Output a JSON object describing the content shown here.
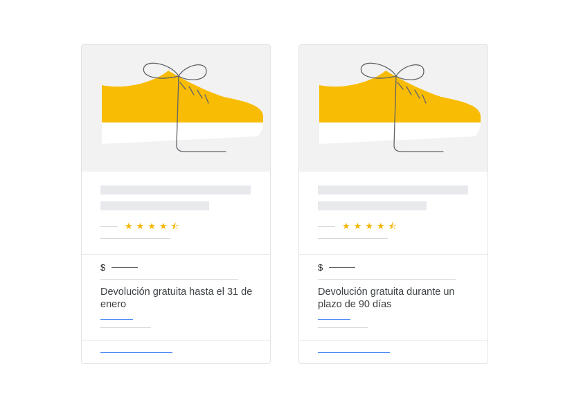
{
  "colors": {
    "shoe": "#f9bc05",
    "sole": "#ffffff",
    "lace": "#5f6368",
    "star": "#f4b400",
    "link": "#4285f4",
    "placeholder": "#e8e9ec"
  },
  "icons": {
    "product": "sneaker-icon",
    "rating": "star-icon"
  },
  "cards": [
    {
      "rating": 4.5,
      "currency": "$",
      "return_text": "Devolución gratuita hasta el 31 de enero"
    },
    {
      "rating": 4.5,
      "currency": "$",
      "return_text": "Devolución gratuita durante un plazo de 90 días"
    }
  ]
}
